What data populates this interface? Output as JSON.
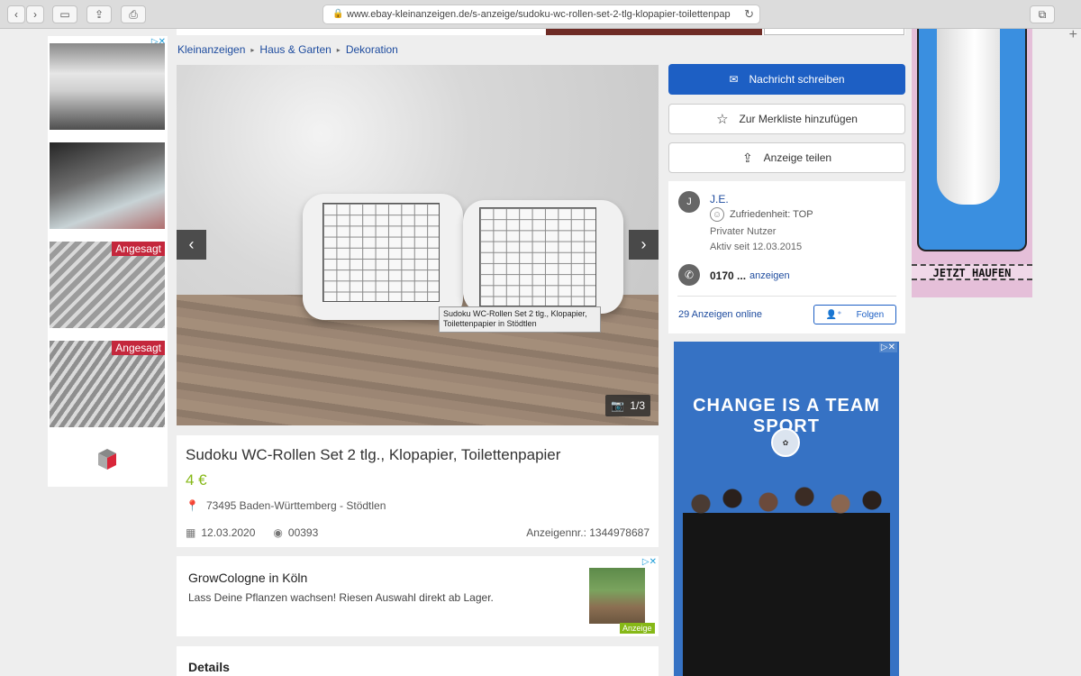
{
  "browser": {
    "url": "www.ebay-kleinanzeigen.de/s-anzeige/sudoku-wc-rollen-set-2-tlg-klopapier-toilettenpap"
  },
  "breadcrumb": [
    "Kleinanzeigen",
    "Haus & Garten",
    "Dekoration"
  ],
  "left_ad": {
    "badges": [
      "Angesagt",
      "Angesagt"
    ]
  },
  "gallery": {
    "counter": "1/3",
    "caption": "Sudoku WC-Rollen Set 2 tlg., Klopapier, Toilettenpapier in Stödtlen"
  },
  "listing": {
    "title": "Sudoku WC-Rollen Set 2 tlg., Klopapier, Toilettenpapier",
    "price": "4 €",
    "location": "73495 Baden-Württemberg - Stödtlen",
    "date": "12.03.2020",
    "views": "00393",
    "ad_number": "Anzeigennr.: 1344978687"
  },
  "text_ad": {
    "title": "GrowCologne in Köln",
    "description": "Lass Deine Pflanzen wachsen! Riesen Auswahl direkt ab Lager.",
    "tag": "Anzeige"
  },
  "details": {
    "title": "Details"
  },
  "actions": {
    "message": "Nachricht schreiben",
    "watchlist": "Zur Merkliste hinzufügen",
    "share": "Anzeige teilen"
  },
  "seller": {
    "initial": "J",
    "name": "J.E.",
    "satisfaction": "Zufriedenheit: TOP",
    "type": "Privater Nutzer",
    "active_since": "Aktiv seit 12.03.2015",
    "phone": "0170 ...",
    "phone_show": "anzeigen",
    "ads_online": "29 Anzeigen online",
    "follow": "Folgen"
  },
  "adidas_ad": {
    "slogan": "CHANGE IS A TEAM SPORT"
  },
  "shoe_ad": {
    "cta": "JETZT HAUFEN"
  },
  "colors": {
    "primary": "#1d5fc4",
    "price": "#86b817",
    "link": "#1d4b9e"
  }
}
